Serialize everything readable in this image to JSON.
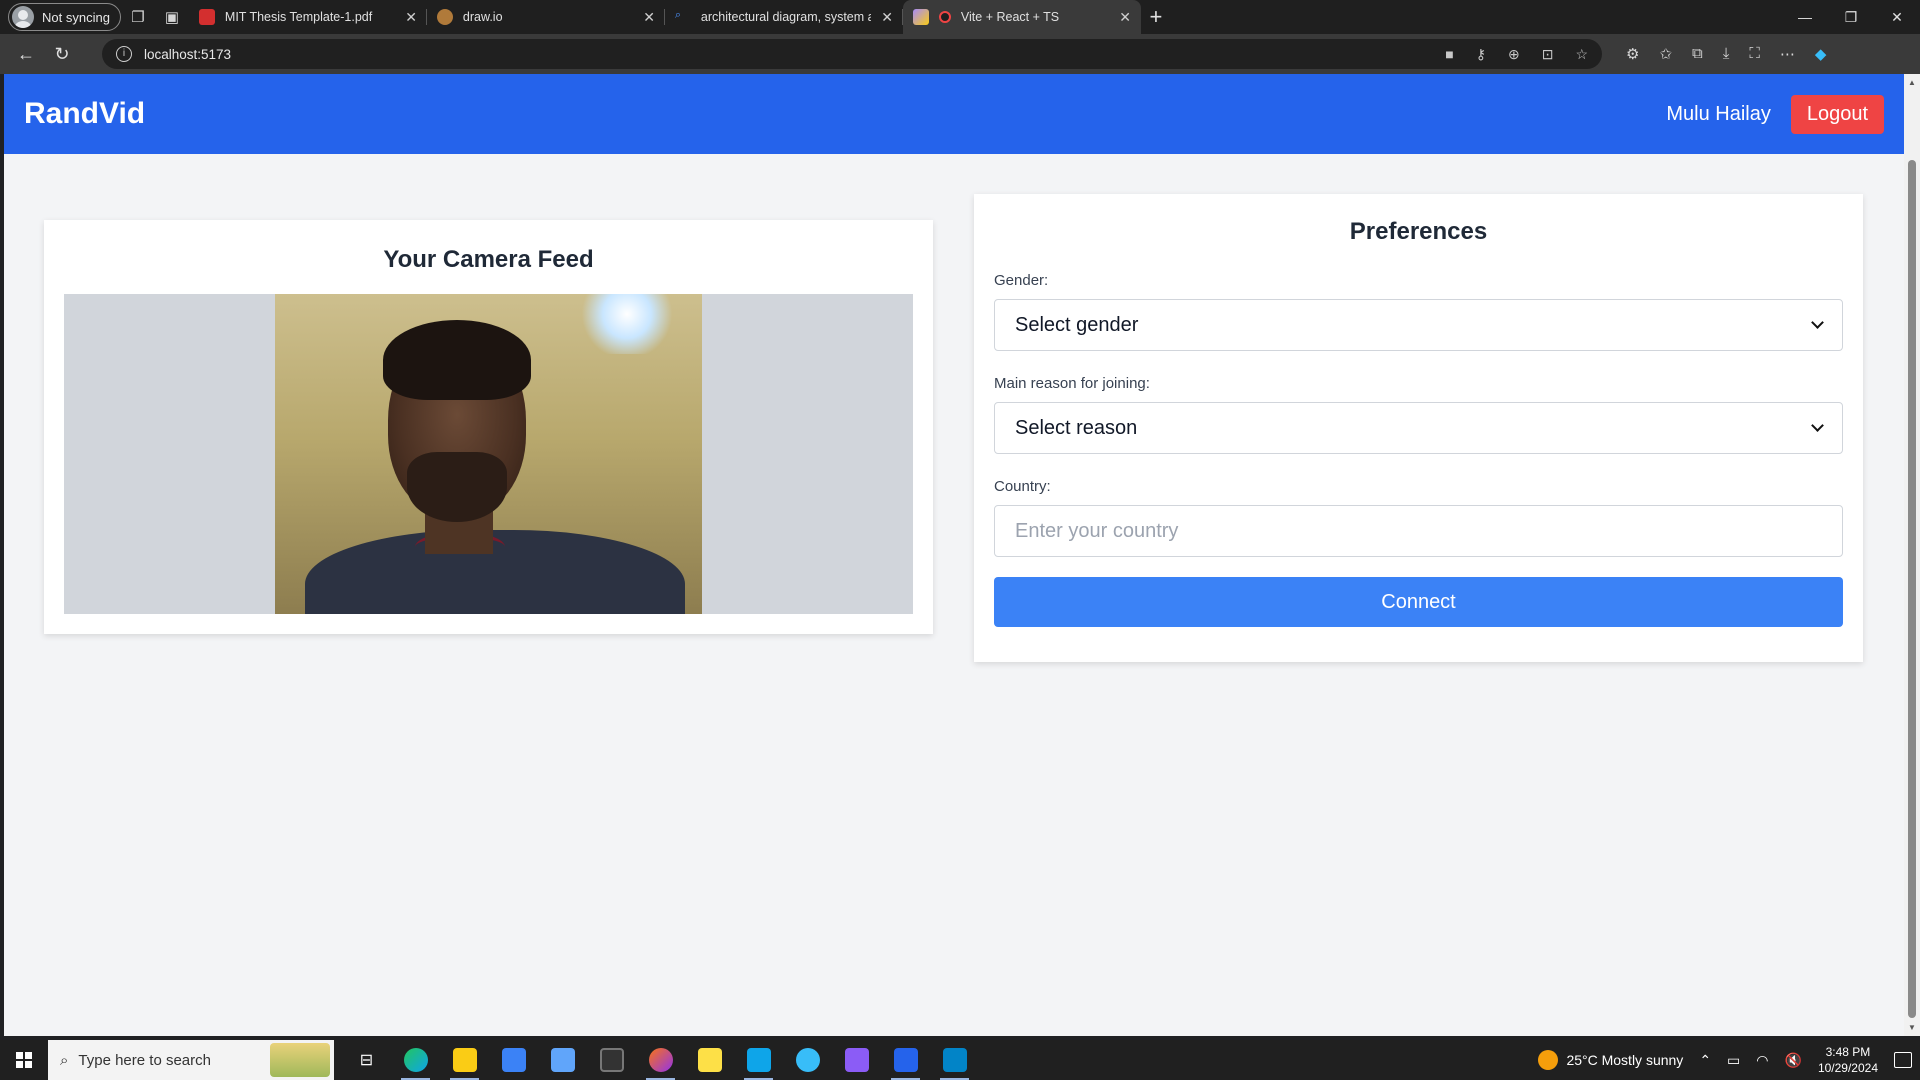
{
  "browser": {
    "profile_label": "Not syncing",
    "tabs": [
      {
        "title": "MIT Thesis Template-1.pdf",
        "active": false
      },
      {
        "title": "draw.io",
        "active": false
      },
      {
        "title": "architectural diagram, system arch",
        "active": false
      },
      {
        "title": "Vite + React + TS",
        "active": true
      }
    ],
    "url": "localhost:5173"
  },
  "app": {
    "brand": "RandVid",
    "username": "Mulu Hailay",
    "logout_label": "Logout",
    "accent_color": "#2563eb",
    "logout_color": "#ef4444"
  },
  "camera": {
    "title": "Your Camera Feed"
  },
  "preferences": {
    "title": "Preferences",
    "gender_label": "Gender:",
    "gender_value": "Select gender",
    "reason_label": "Main reason for joining:",
    "reason_value": "Select reason",
    "country_label": "Country:",
    "country_placeholder": "Enter your country",
    "connect_label": "Connect"
  },
  "taskbar": {
    "search_placeholder": "Type here to search",
    "weather": "25°C  Mostly sunny",
    "time": "3:48 PM",
    "date": "10/29/2024"
  }
}
